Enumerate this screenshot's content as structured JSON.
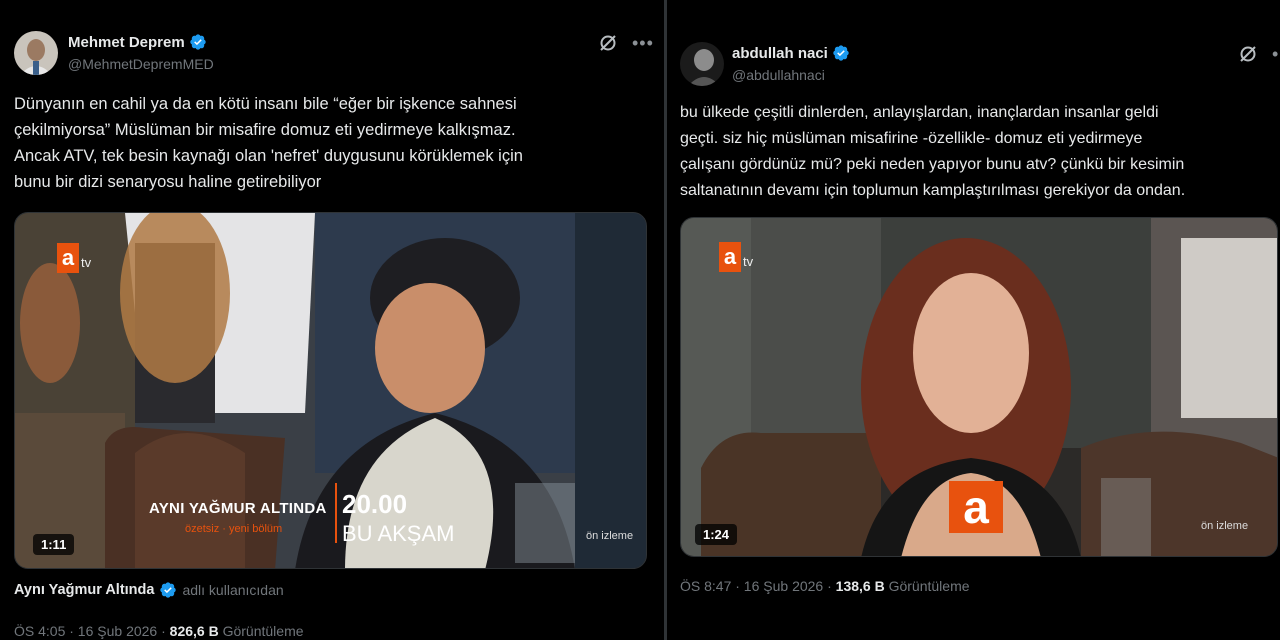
{
  "left_tweet": {
    "author_name": "Mehmet Deprem",
    "author_handle": "@MehmetDepremMED",
    "text": "Dünyanın en cahil ya da en kötü insanı bile “eğer bir işkence sahnesi\nçekilmiyorsa” Müslüman bir misafire domuz eti yedirmeye kalkışmaz.\nAncak ATV, tek besin kaynağı olan 'nefret' duygusunu körüklemek için\nbunu bir dizi senaryosu haline getirebiliyor",
    "video": {
      "duration": "1:11",
      "channel_logo_letter": "a",
      "channel_logo_suffix": "tv",
      "show_title": "AYNI YAĞMUR ALTINDA",
      "show_subtitle": "özetsiz · yeni bölüm",
      "air_time": "20.00",
      "air_day": "BU AKŞAM",
      "preview_label": "ön izleme"
    },
    "from_account": "Aynı Yağmur Altında",
    "from_label": "adlı kullanıcıdan",
    "time": "ÖS 4:05 · 16 Şub 2026 ·",
    "views": "826,6 B",
    "views_label": "Görüntüleme"
  },
  "right_tweet": {
    "author_name": "abdullah naci",
    "author_handle": "@abdullahnaci",
    "text": "bu ülkede çeşitli dinlerden, anlayışlardan, inançlardan insanlar geldi\ngeçti. siz hiç müslüman misafirine -özellikle- domuz eti yedirmeye\nçalışanı gördünüz mü? peki neden yapıyor bunu atv? çünkü bir kesimin\nsaltanatının devamı için toplumun kamplaştırılması gerekiyor da ondan.",
    "video": {
      "duration": "1:24",
      "channel_logo_letter": "a",
      "channel_logo_suffix": "tv",
      "watermark_letter": "a",
      "preview_label": "ön izleme"
    },
    "time": "ÖS 8:47 · 16 Şub 2026 ·",
    "views": "138,6 B",
    "views_label": "Görüntüleme"
  },
  "icons": {
    "verified": "verified-badge-icon",
    "grok": "grok-icon",
    "more": "more-icon"
  },
  "colors": {
    "background": "#000000",
    "text_primary": "#e7e9ea",
    "text_secondary": "#71767b",
    "verified_blue": "#1d9bf0",
    "atv_orange": "#e8520e"
  }
}
